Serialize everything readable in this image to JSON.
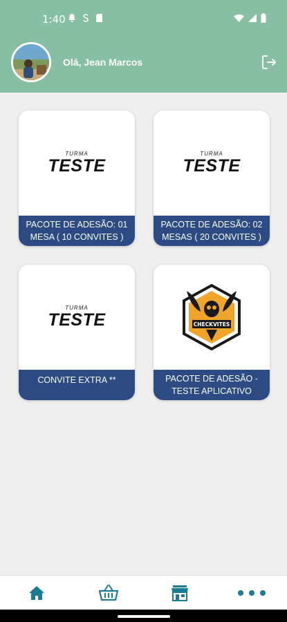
{
  "status_bar": {
    "time": "1:40"
  },
  "header": {
    "greeting": "Olá, Jean Marcos"
  },
  "packages": [
    {
      "brand_small": "TURMA",
      "brand_big": "TESTE",
      "label": "PACOTE DE ADESÃO: 01 MESA ( 10 CONVITES )"
    },
    {
      "brand_small": "TURMA",
      "brand_big": "TESTE",
      "label": "PACOTE DE ADESÃO: 02 MESAS ( 20 CONVITES )"
    },
    {
      "brand_small": "TURMA",
      "brand_big": "TESTE",
      "label": "CONVITE EXTRA **"
    },
    {
      "brand_small": "CHECKVITES",
      "label": "PACOTE DE ADESÃO - TESTE APLICATIVO"
    }
  ],
  "nav": {
    "items": [
      {
        "icon": "home-icon"
      },
      {
        "icon": "basket-icon"
      },
      {
        "icon": "store-icon"
      },
      {
        "icon": "more-icon"
      }
    ]
  },
  "colors": {
    "header": "#86bfa1",
    "label_bg": "#2c4a84",
    "nav_icon": "#1b7b92",
    "background": "#efefef"
  }
}
